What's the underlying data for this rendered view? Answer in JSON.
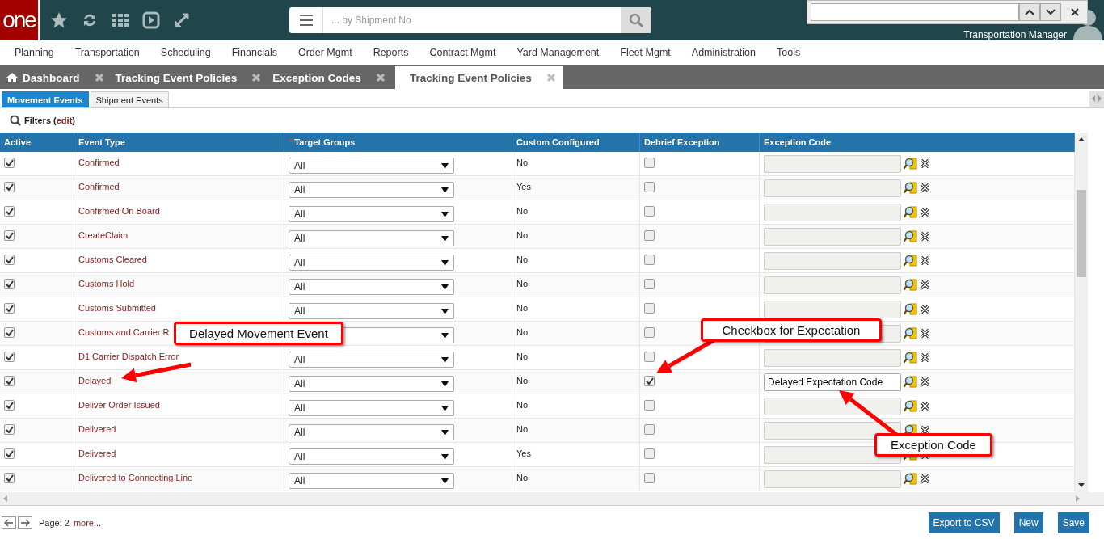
{
  "header": {
    "logo": "one",
    "search": {
      "placeholder": "... by Shipment No"
    },
    "user_role": "Transportation Manager"
  },
  "menu": [
    "Planning",
    "Transportation",
    "Scheduling",
    "Financials",
    "Order Mgmt",
    "Reports",
    "Contract Mgmt",
    "Yard Management",
    "Fleet Mgmt",
    "Administration",
    "Tools"
  ],
  "tabs": [
    {
      "label": "Dashboard",
      "selected": false,
      "home": true
    },
    {
      "label": "Tracking Event Policies",
      "selected": false,
      "home": false
    },
    {
      "label": "Exception Codes",
      "selected": false,
      "home": false
    },
    {
      "label": "Tracking Event Policies",
      "selected": true,
      "home": false
    }
  ],
  "subtabs": [
    {
      "label": "Movement Events",
      "selected": true
    },
    {
      "label": "Shipment Events",
      "selected": false
    }
  ],
  "filters": {
    "label": "Filters",
    "paren_open": "(",
    "link": "edit",
    "paren_close": ")"
  },
  "table": {
    "columns": [
      {
        "label": "Active"
      },
      {
        "label": "Event Type"
      },
      {
        "label": "Target Groups",
        "required_mark": "*"
      },
      {
        "label": "Custom Configured"
      },
      {
        "label": "Debrief Exception"
      },
      {
        "label": "Exception Code"
      }
    ],
    "rows": [
      {
        "active": true,
        "event_type": "Confirmed",
        "target_group": "All",
        "custom": "No",
        "debrief": false
      },
      {
        "active": true,
        "event_type": "Confirmed",
        "target_group": "All",
        "custom": "Yes",
        "debrief": false
      },
      {
        "active": true,
        "event_type": "Confirmed On Board",
        "target_group": "All",
        "custom": "No",
        "debrief": false
      },
      {
        "active": true,
        "event_type": "CreateClaim",
        "target_group": "All",
        "custom": "No",
        "debrief": false
      },
      {
        "active": true,
        "event_type": "Customs Cleared",
        "target_group": "All",
        "custom": "No",
        "debrief": false
      },
      {
        "active": true,
        "event_type": "Customs Hold",
        "target_group": "All",
        "custom": "No",
        "debrief": false
      },
      {
        "active": true,
        "event_type": "Customs Submitted",
        "target_group": "All",
        "custom": "No",
        "debrief": false
      },
      {
        "active": true,
        "event_type": "Customs and Carrier R",
        "custom": "No",
        "debrief": false
      },
      {
        "active": true,
        "event_type": "D1 Carrier Dispatch Error",
        "target_group": "All",
        "custom": "No",
        "debrief": false
      },
      {
        "active": true,
        "event_type": "Delayed",
        "target_group": "All",
        "custom": "No",
        "debrief": true,
        "exception_code": "Delayed Expectation Code"
      },
      {
        "active": true,
        "event_type": "Deliver Order Issued",
        "target_group": "All",
        "custom": "No",
        "debrief": false
      },
      {
        "active": true,
        "event_type": "Delivered",
        "target_group": "All",
        "custom": "No",
        "debrief": false
      },
      {
        "active": true,
        "event_type": "Delivered",
        "target_group": "All",
        "custom": "Yes",
        "debrief": false
      },
      {
        "active": true,
        "event_type": "Delivered to Connecting Line",
        "target_group": "All",
        "custom": "No",
        "debrief": false
      }
    ]
  },
  "footer": {
    "page_label": "Page: 2",
    "more_link": "more...",
    "buttons": [
      "Export to CSV",
      "New",
      "Save"
    ]
  },
  "annotations": [
    "Delayed Movement Event",
    "Checkbox for Expectation",
    "Exception Code"
  ]
}
